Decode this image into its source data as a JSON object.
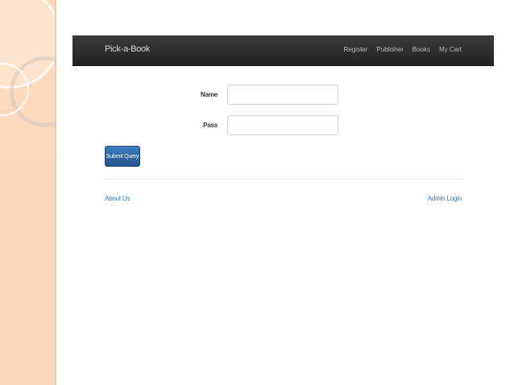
{
  "navbar": {
    "brand": "Pick-a-Book",
    "links": [
      "Register",
      "Publisher",
      "Books",
      "My Cart"
    ]
  },
  "form": {
    "name_label": "Name",
    "name_value": "",
    "pass_label": "Pass",
    "pass_value": "",
    "submit_label": "Submit Query"
  },
  "footer": {
    "about_label": "About Us",
    "admin_label": "Admin Login"
  },
  "colors": {
    "navbar": "#2b2b2b",
    "button": "#2f6aa8",
    "link": "#3a73b5",
    "side_band": "#fcd9bd"
  }
}
